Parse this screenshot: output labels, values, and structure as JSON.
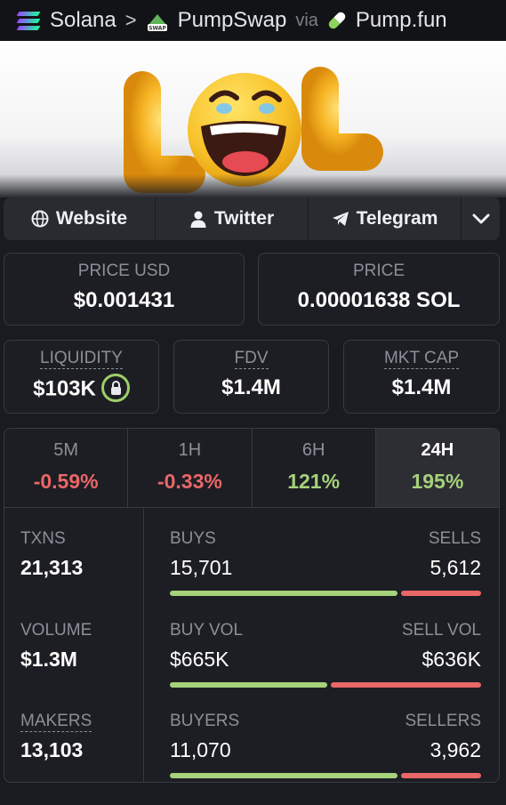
{
  "header": {
    "chain": "Solana",
    "separator": ">",
    "dex": "PumpSwap",
    "dex_icon_text": "SWAP",
    "via": "via",
    "launchpad": "Pump.fun"
  },
  "banner": {
    "icon": "lol-laughing-emoji-image"
  },
  "links": {
    "website": "Website",
    "twitter": "Twitter",
    "telegram": "Telegram"
  },
  "price": {
    "usd_label": "PRICE USD",
    "usd_value": "$0.001431",
    "native_label": "PRICE",
    "native_value": "0.00001638 SOL"
  },
  "metrics": {
    "liquidity_label": "LIQUIDITY",
    "liquidity_value": "$103K",
    "fdv_label": "FDV",
    "fdv_value": "$1.4M",
    "mktcap_label": "MKT CAP",
    "mktcap_value": "$1.4M"
  },
  "timeframes": [
    {
      "label": "5M",
      "change": "-0.59%",
      "positive": false
    },
    {
      "label": "1H",
      "change": "-0.33%",
      "positive": false
    },
    {
      "label": "6H",
      "change": "121%",
      "positive": true
    },
    {
      "label": "24H",
      "change": "195%",
      "positive": true,
      "active": true
    }
  ],
  "stats": {
    "txns_label": "TXNS",
    "txns": "21,313",
    "volume_label": "VOLUME",
    "volume": "$1.3M",
    "makers_label": "MAKERS",
    "makers": "13,103"
  },
  "breakdown": {
    "buys_label": "BUYS",
    "buys": "15,701",
    "sells_label": "SELLS",
    "sells": "5,612",
    "buy_ratio": 0.737,
    "buyvol_label": "BUY VOL",
    "buyvol": "$665K",
    "sellvol_label": "SELL VOL",
    "sellvol": "$636K",
    "buyvol_ratio": 0.511,
    "buyers_label": "BUYERS",
    "buyers": "11,070",
    "sellers_label": "SELLERS",
    "sellers": "3,962",
    "buyers_ratio": 0.737
  },
  "colors": {
    "positive": "#a5d27a",
    "negative": "#ea6767",
    "background": "#1a1b20",
    "card_border": "#383a42"
  }
}
